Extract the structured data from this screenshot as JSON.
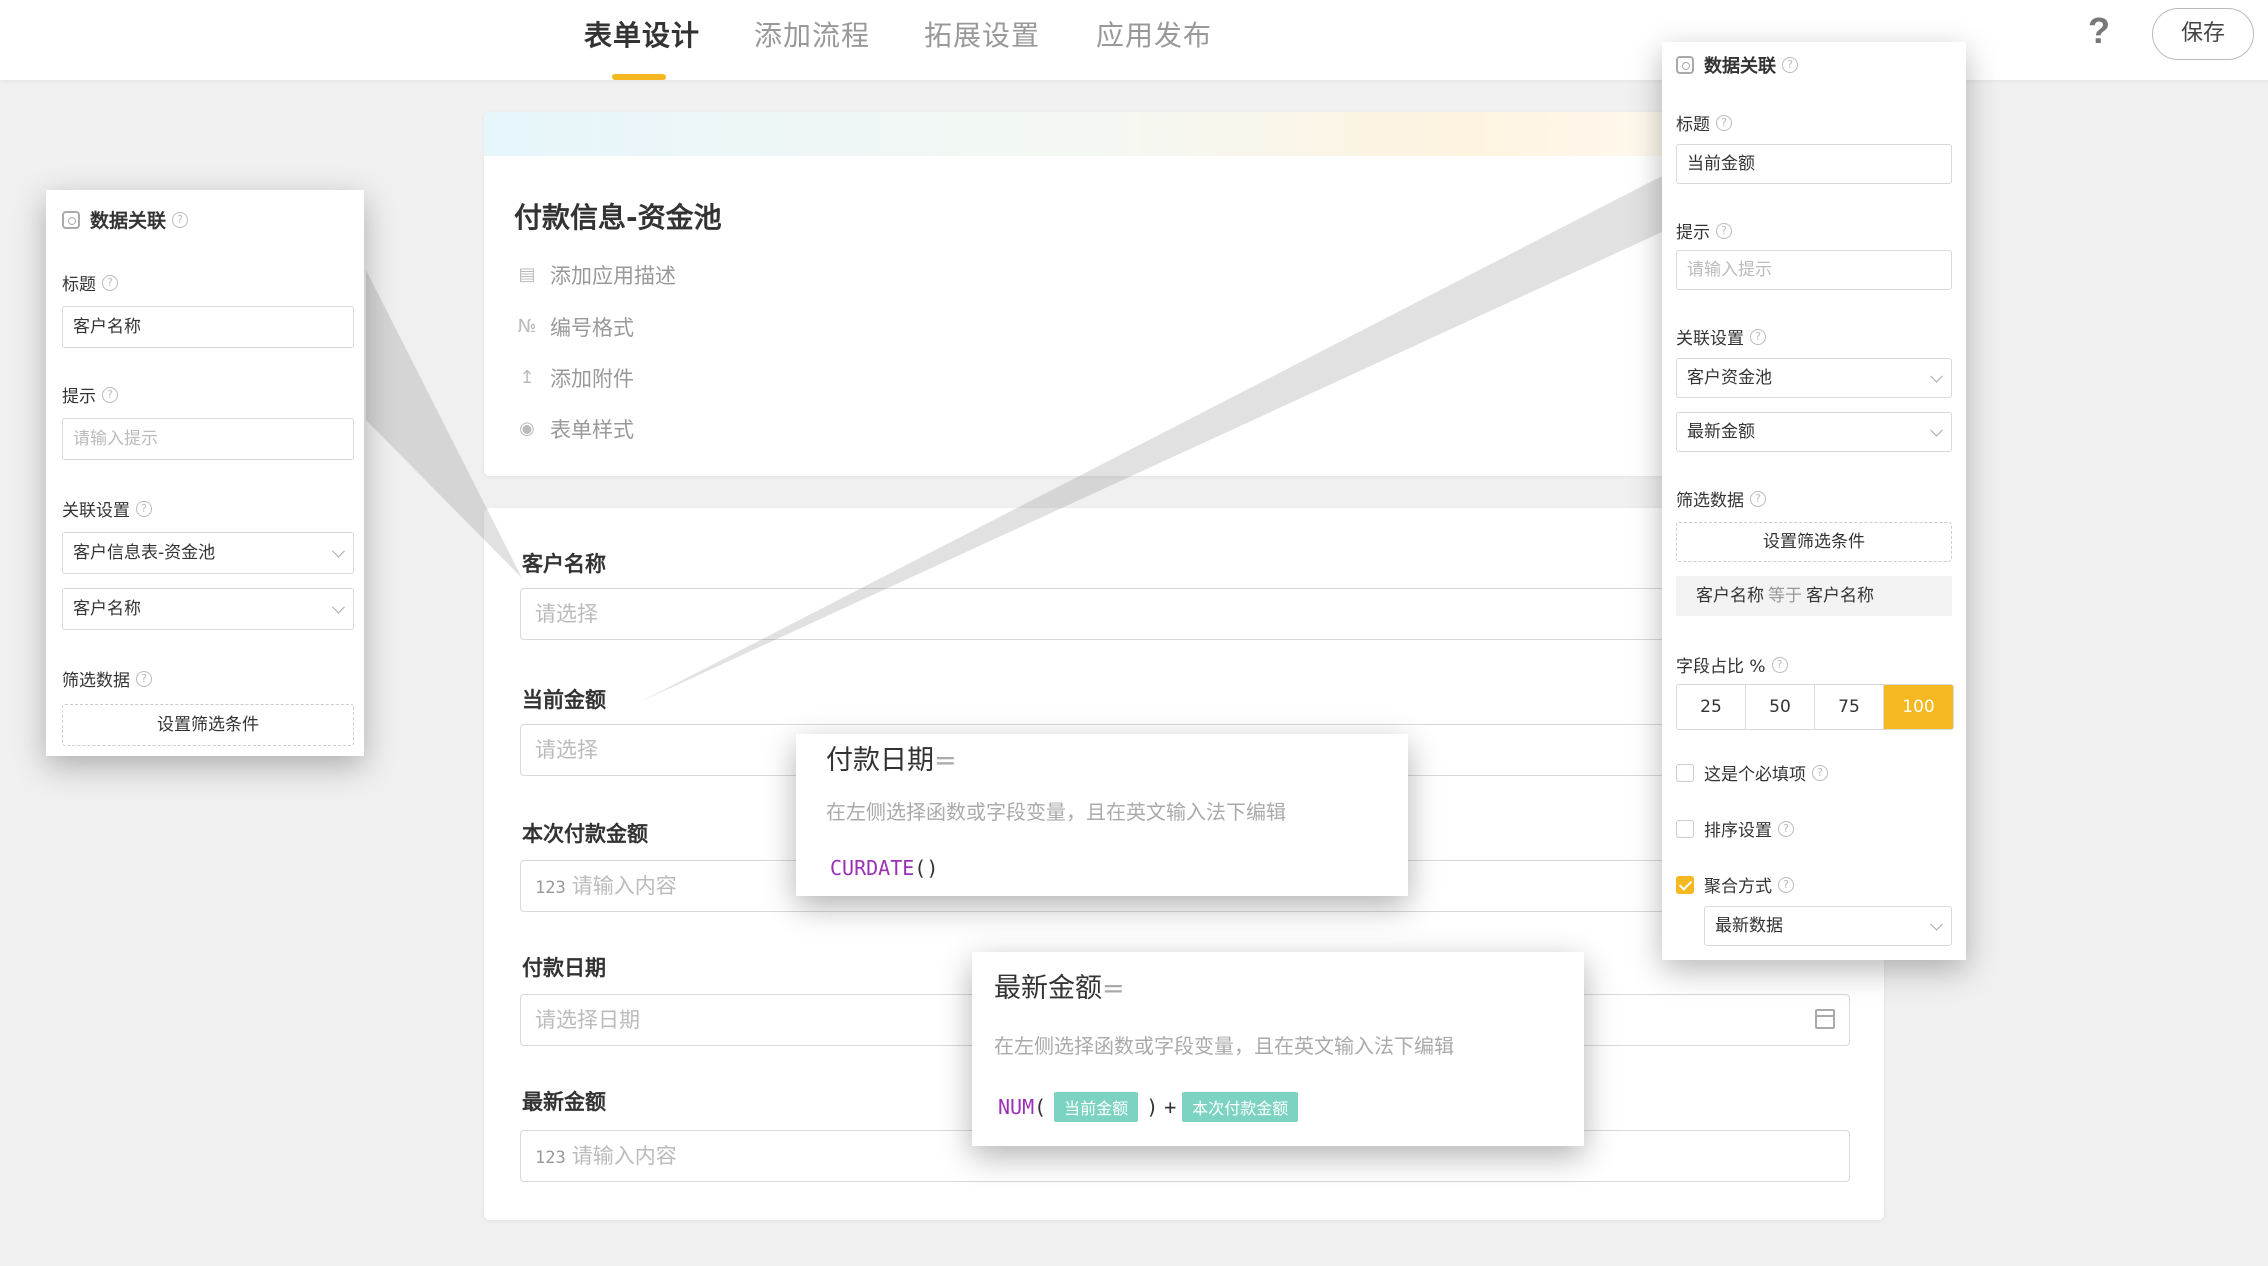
{
  "header": {
    "tabs": [
      {
        "label": "表单设计",
        "active": true
      },
      {
        "label": "添加流程",
        "active": false
      },
      {
        "label": "拓展设置",
        "active": false
      },
      {
        "label": "应用发布",
        "active": false
      }
    ],
    "help_symbol": "?",
    "save_label": "保存"
  },
  "form_card": {
    "title": "付款信息-资金池",
    "menu": [
      {
        "icon": "comment-icon",
        "label": "添加应用描述"
      },
      {
        "icon": "number-format-icon",
        "label": "编号格式"
      },
      {
        "icon": "upload-icon",
        "label": "添加附件"
      },
      {
        "icon": "palette-icon",
        "label": "表单样式"
      }
    ]
  },
  "form_fields": [
    {
      "label": "客户名称",
      "placeholder": "请选择",
      "kind": "select"
    },
    {
      "label": "当前金额",
      "placeholder": "请选择",
      "kind": "select"
    },
    {
      "label": "本次付款金额",
      "placeholder": "请输入内容",
      "kind": "number",
      "prefix": "123"
    },
    {
      "label": "付款日期",
      "placeholder": "请选择日期",
      "kind": "date"
    },
    {
      "label": "最新金额",
      "placeholder": "请输入内容",
      "kind": "number",
      "prefix": "123"
    }
  ],
  "left_panel": {
    "header": "数据关联",
    "title_label": "标题",
    "title_value": "客户名称",
    "hint_label": "提示",
    "hint_placeholder": "请输入提示",
    "link_label": "关联设置",
    "link_table": "客户信息表-资金池",
    "link_field": "客户名称",
    "filter_label": "筛选数据",
    "filter_button": "设置筛选条件"
  },
  "right_panel": {
    "header": "数据关联",
    "title_label": "标题",
    "title_value": "当前金额",
    "hint_label": "提示",
    "hint_placeholder": "请输入提示",
    "link_label": "关联设置",
    "link_table": "客户资金池",
    "link_field": "最新金额",
    "filter_label": "筛选数据",
    "filter_button": "设置筛选条件",
    "condition": {
      "field": "客户名称",
      "op": "等于",
      "value": "客户名称"
    },
    "width_label": "字段占比 %",
    "width_options": [
      "25",
      "50",
      "75",
      "100"
    ],
    "width_selected": "100",
    "required_label": "这是个必填项",
    "required_checked": false,
    "sort_label": "排序设置",
    "sort_checked": false,
    "agg_label": "聚合方式",
    "agg_checked": true,
    "agg_value": "最新数据"
  },
  "formula_date": {
    "title": "付款日期",
    "eq": "=",
    "hint": "在左侧选择函数或字段变量，且在英文输入法下编辑",
    "fn": "CURDATE",
    "parens": "()"
  },
  "formula_amount": {
    "title": "最新金额",
    "eq": "=",
    "hint": "在左侧选择函数或字段变量，且在英文输入法下编辑",
    "fn": "NUM",
    "open": "(",
    "arg1": "当前金额",
    "close": ")",
    "op": "+",
    "arg2": "本次付款金额"
  },
  "colors": {
    "accent": "#f5b820",
    "tag": "#7cd3c1",
    "function": "#9b2fb5"
  }
}
